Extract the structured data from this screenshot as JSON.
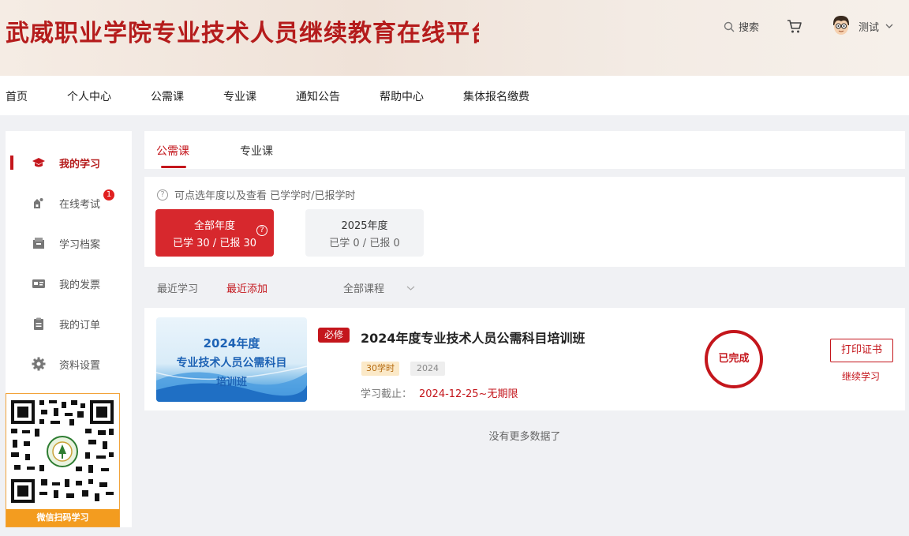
{
  "header": {
    "site_title": "武威职业学院专业技术人员继续教育在线平台",
    "search_label": "搜索",
    "user_name": "测试"
  },
  "nav": {
    "items": [
      "首页",
      "个人中心",
      "公需课",
      "专业课",
      "通知公告",
      "帮助中心",
      "集体报名缴费"
    ]
  },
  "sidebar": {
    "items": [
      {
        "label": "我的学习",
        "icon": "graduation-cap-icon",
        "active": true
      },
      {
        "label": "在线考试",
        "icon": "exam-icon",
        "badge": "1"
      },
      {
        "label": "学习档案",
        "icon": "archive-icon"
      },
      {
        "label": "我的发票",
        "icon": "invoice-icon"
      },
      {
        "label": "我的订单",
        "icon": "order-icon"
      },
      {
        "label": "资料设置",
        "icon": "gear-icon"
      }
    ],
    "qr_caption": "微信扫码学习"
  },
  "tabs": {
    "items": [
      "公需课",
      "专业课"
    ],
    "active": "公需课"
  },
  "year_filter": {
    "hint": "可点选年度以及查看 已学学时/已报学时",
    "cards": [
      {
        "title": "全部年度",
        "stats": "已学 30 / 已报 30",
        "active": true
      },
      {
        "title": "2025年度",
        "stats": "已学 0 / 已报 0",
        "active": false
      }
    ]
  },
  "filters": {
    "recent_study": "最近学习",
    "recent_added": "最近添加",
    "all_courses": "全部课程"
  },
  "course": {
    "thumb_line1": "2024年度",
    "thumb_line2": "专业技术人员公需科目",
    "thumb_line3": "培训班",
    "badge": "必修",
    "title": "2024年度专业技术人员公需科目培训班",
    "hours": "30学时",
    "year": "2024",
    "deadline_label": "学习截止：",
    "deadline_value": "2024-12-25~无期限",
    "status": "已完成",
    "print_label": "打印证书",
    "continue_label": "继续学习"
  },
  "footer_note": "没有更多数据了",
  "colors": {
    "brand_red": "#c4161c",
    "qr_orange": "#f39c1f"
  }
}
